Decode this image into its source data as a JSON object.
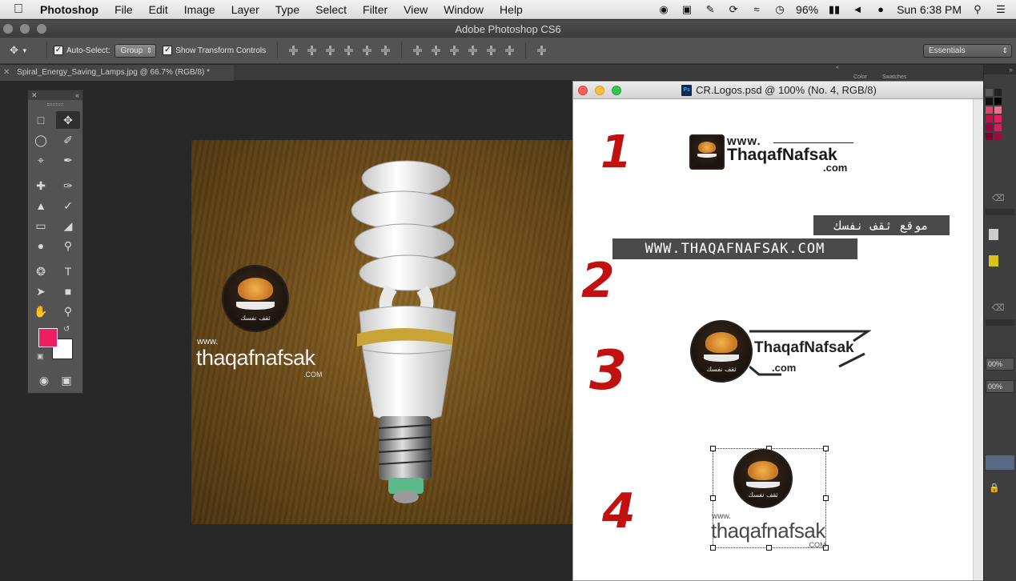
{
  "menubar": {
    "app_name": "Photoshop",
    "items": [
      "File",
      "Edit",
      "Image",
      "Layer",
      "Type",
      "Select",
      "Filter",
      "View",
      "Window",
      "Help"
    ],
    "battery": "96%",
    "clock": "Sun 6:38 PM"
  },
  "window": {
    "title": "Adobe Photoshop CS6"
  },
  "options": {
    "auto_select_label": "Auto-Select:",
    "auto_select_value": "Group",
    "show_transform_label": "Show Transform Controls",
    "workspace": "Essentials"
  },
  "tabs": {
    "active_doc": "Spiral_Energy_Saving_Lamps.jpg @ 66.7% (RGB/8) *"
  },
  "photo": {
    "watermark_www": "www.",
    "watermark_name": "thaqafnafsak",
    "watermark_com": ".COM",
    "emblem_arabic": "ثقف نفسك"
  },
  "docwin": {
    "title": "CR.Logos.psd @ 100% (No. 4, RGB/8)",
    "psd_icon_label": "Ps",
    "numbers": [
      "1",
      "2",
      "3",
      "4"
    ],
    "logo1": {
      "www": "www.",
      "name": "ThaqafNafsak",
      "com": ".com"
    },
    "logo2": {
      "arabic": "موقع ثقف نفسك",
      "url": "WWW.THAQAFNAFSAK.COM"
    },
    "logo3": {
      "name": "ThaqafNafsak",
      "com": ".com"
    },
    "logo4": {
      "www": "www.",
      "name": "thaqafnafsak",
      "com": ".COM"
    },
    "emblem_arabic": "ثقف نفسك"
  },
  "panels": {
    "pct_1": "00%",
    "pct_2": "00%",
    "partial_tab_1": "Color",
    "partial_tab_2": "Swatches"
  },
  "colors": {
    "foreground": "#ef1d61",
    "background": "#ffffff"
  }
}
